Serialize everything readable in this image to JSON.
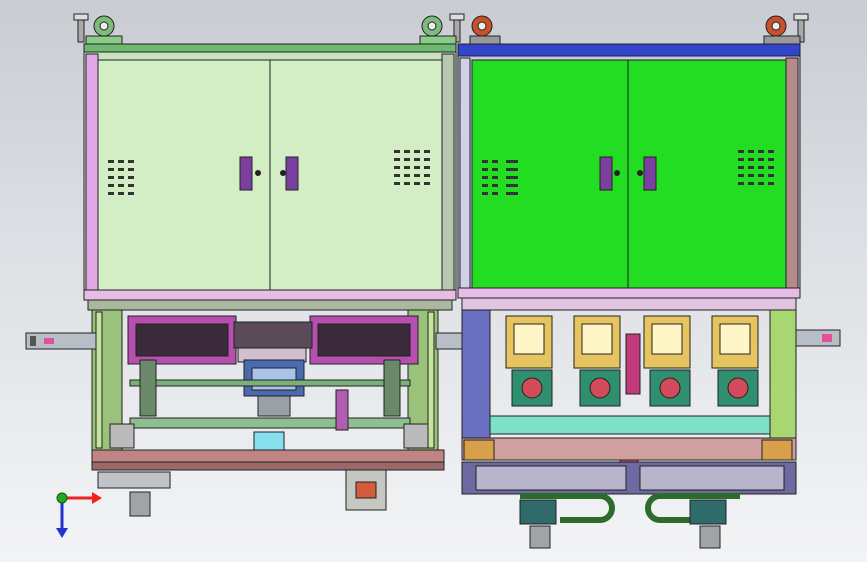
{
  "scene": {
    "background_top": "#c9cdd3",
    "background_bottom": "#f3f4f6"
  },
  "machines": [
    {
      "id": "left-unit",
      "cabinet_color": "#d3eec4",
      "trim_color": "#e2a6e6",
      "caster_color": "#7dbb7d"
    },
    {
      "id": "right-unit",
      "cabinet_color": "#22dd22",
      "trim_color": "#3344cc",
      "caster_color": "#c8502a"
    }
  ],
  "triad": {
    "axes": [
      "x",
      "y",
      "z"
    ],
    "x_color": "#ee2222",
    "y_color": "#22aa22",
    "z_color": "#2233cc"
  }
}
